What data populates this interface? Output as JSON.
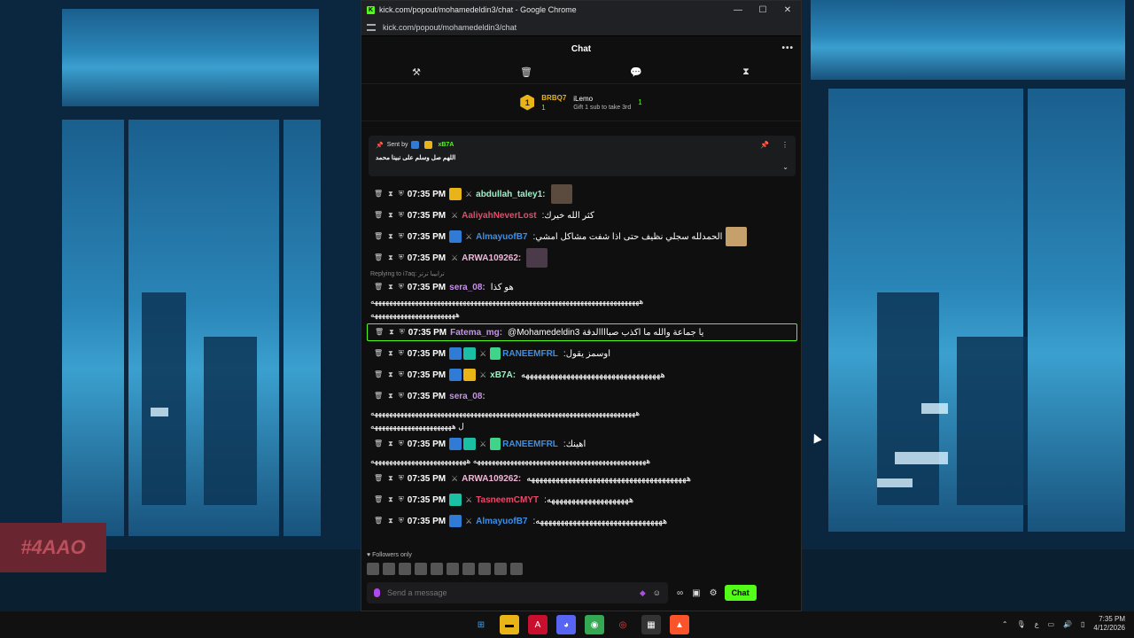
{
  "window": {
    "title": "kick.com/popout/mohamedeldin3/chat - Google Chrome",
    "url": "kick.com/popout/mohamedeldin3/chat",
    "controls": [
      "—",
      "☐",
      "✕"
    ]
  },
  "chat": {
    "header": "Chat",
    "toolbar_icons": [
      "hammer-icon",
      "trash-icon",
      "chat-bubble-icon",
      "hourglass-icon"
    ],
    "leaderboard": {
      "first": {
        "rank": "1",
        "name": "BRBQ7",
        "count": "1"
      },
      "second": {
        "name": "iLemo",
        "count": "1",
        "note": "Gift 1 sub to take 3rd"
      }
    },
    "pinned": {
      "sent_by_label": "Sent by",
      "user": "xB7A",
      "message": "اللهم صل وسلم على نبينا محمد"
    },
    "messages": [
      {
        "time": "07:35 PM",
        "user": "abdullah_taley1:",
        "user_color": "#9bf2c4",
        "text": "",
        "thumb": true,
        "badges": [
          "gold",
          "sword"
        ]
      },
      {
        "time": "07:35 PM",
        "user": "AaliyahNeverLost",
        "user_color": "#e84a6a",
        "text": ":كثر الله خيرك",
        "badges": [
          "sword"
        ]
      },
      {
        "time": "07:35 PM",
        "user": "AlmayuofB7",
        "user_color": "#3d8fe6",
        "text": ":الحمدلله سجلي نظيف حتى اذا شفت مشاكل امشي",
        "thumb": true,
        "badges": [
          "blue",
          "sword"
        ]
      },
      {
        "time": "07:35 PM",
        "user": "ARWA109262:",
        "user_color": "#f0b6d6",
        "text": "",
        "thumb": true,
        "badges": [
          "sword"
        ]
      },
      {
        "time": "07:35 PM",
        "user": "sera_08:",
        "user_color": "#c792ea",
        "text": "هو كذا",
        "badges": []
      },
      {
        "time": "07:35 PM",
        "user": "Fatema_mg:",
        "user_color": "#c792ea",
        "text": "@Mohamedeldin3 يا جماعة والله ما اكذب صباااالدقة",
        "badges": []
      },
      {
        "time": "07:35 PM",
        "user": "RANEEMFRL",
        "user_color": "#3d8fe6",
        "text": ":اوسمز يقول",
        "badges": [
          "blue",
          "teal",
          "sword",
          "gift"
        ]
      },
      {
        "time": "07:35 PM",
        "user": "xB7A:",
        "user_color": "#9bf2c4",
        "text": "ههههههههههههههههههههههههههههههههههه",
        "badges": [
          "blue",
          "gold",
          "sword"
        ]
      },
      {
        "time": "07:35 PM",
        "user": "sera_08:",
        "user_color": "#c792ea",
        "text": "",
        "badges": []
      },
      {
        "time": "07:35 PM",
        "user": "RANEEMFRL",
        "user_color": "#3d8fe6",
        "text": ":اهينك",
        "badges": [
          "blue",
          "teal",
          "sword",
          "gift"
        ]
      },
      {
        "time": "07:35 PM",
        "user": "ARWA109262:",
        "user_color": "#f0b6d6",
        "text": "هههههههههههههههههههههههههههههههههههههههه",
        "badges": [
          "sword"
        ]
      },
      {
        "time": "07:35 PM",
        "user": "TasneemCMYT",
        "user_color": "#e84a6a",
        "text": ":ههههههههههههههههههههه",
        "badges": [
          "teal",
          "sword"
        ]
      },
      {
        "time": "07:35 PM",
        "user": "AlmayuofB7",
        "user_color": "#3d8fe6",
        "text": ":هههههههههههههههههههههههههههههههه",
        "badges": [
          "blue",
          "sword"
        ]
      }
    ],
    "reply_text": "Replying to i7aq: ترابيبا ترتر",
    "long_lines": {
      "after_sera": "هههههههههههههههههههههههههههههههههههههههههههههههههههههههههههههههههههههههههه",
      "after_sera_2": "هههههههههههههههههههههههه",
      "after_sera2": "ههههههههههههههههههههههههههههههههههههههههههههههههههههههههههههههههههههههههه",
      "after_sera2_2": "ل ههههههههههههههههههههههه",
      "after_raneem": "هههههههههههههههههههههههههههههههههههههههههههههههه ههههههههههههههههههههههههههه"
    },
    "followers_only": "Followers only",
    "input_placeholder": "Send a message",
    "chat_button": "Chat"
  },
  "taskbar": {
    "time": "7:35 PM",
    "date": "4/12/2026",
    "lang": "ع"
  },
  "watermark": "#4AAO"
}
